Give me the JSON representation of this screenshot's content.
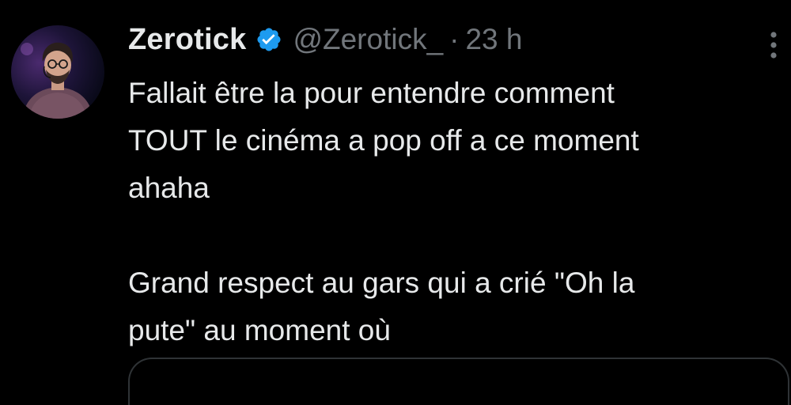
{
  "tweet": {
    "display_name": "Zerotick",
    "handle": "@Zerotick_",
    "separator": "·",
    "time": "23 h",
    "verified": true,
    "text": "Fallait être la pour entendre comment\nTOUT le cinéma a pop off a ce moment\nahaha\n\nGrand respect au gars qui a crié \"Oh la\npute\" au moment où"
  },
  "icons": {
    "verified": "verified-badge-icon",
    "more": "more-options-icon",
    "avatar": "profile-avatar"
  },
  "colors": {
    "background": "#000000",
    "primary_text": "#e7e9ea",
    "secondary_text": "#71767b",
    "verified_blue": "#1d9bf0",
    "border": "#2f3336"
  }
}
